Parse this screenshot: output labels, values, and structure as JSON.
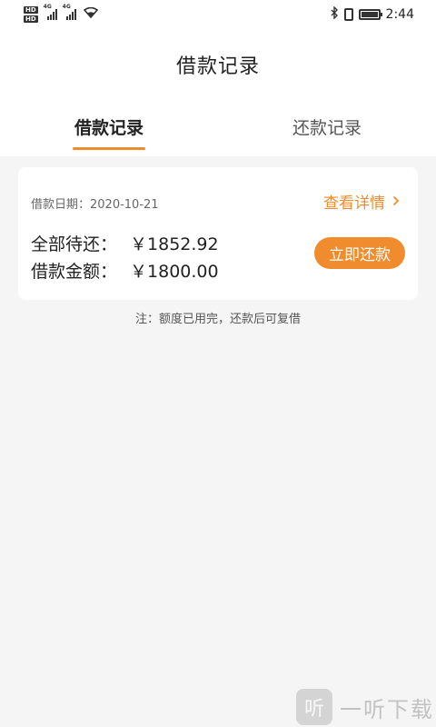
{
  "status_bar": {
    "hd_badges": [
      "HD",
      "HD"
    ],
    "network_1": "4G",
    "network_2": "4G",
    "time": "2:44",
    "icons": [
      "signal-icon",
      "wifi-icon",
      "bluetooth-icon",
      "vibrate-icon",
      "battery-icon"
    ]
  },
  "header": {
    "title": "借款记录"
  },
  "tabs": [
    {
      "label": "借款记录",
      "active": true
    },
    {
      "label": "还款记录",
      "active": false
    }
  ],
  "loan": {
    "date_label": "借款日期：2020-10-21",
    "detail_link": "查看详情",
    "total_label": "全部待还：",
    "total_value": "￥1852.92",
    "borrowed_label": "借款金额：",
    "borrowed_value": "￥1800.00",
    "repay_button": "立即还款"
  },
  "note": "注：额度已用完，还款后可复借",
  "watermark": {
    "logo": "听",
    "text": "一听下载"
  },
  "colors": {
    "accent": "#f08c2e",
    "background": "#f5f5f5",
    "card": "#ffffff"
  }
}
